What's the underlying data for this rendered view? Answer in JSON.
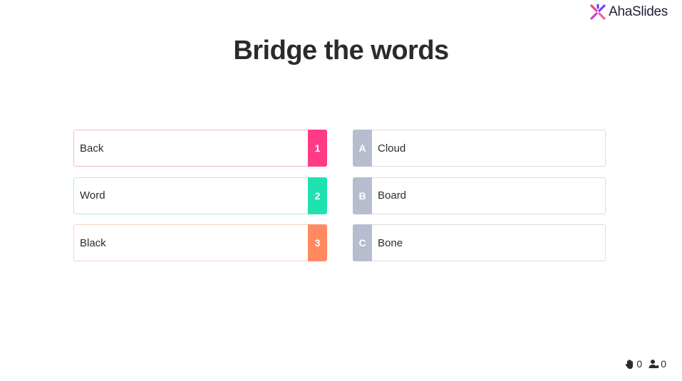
{
  "brand": {
    "name": "AhaSlides",
    "logo_icon": "ahaslides-logo-icon"
  },
  "slide": {
    "title": "Bridge the words"
  },
  "left_items": [
    {
      "text": "Back",
      "badge": "1",
      "color": "#ff3b86"
    },
    {
      "text": "Word",
      "badge": "2",
      "color": "#1ee2b0"
    },
    {
      "text": "Black",
      "badge": "3",
      "color": "#ff8a62"
    }
  ],
  "right_items": [
    {
      "text": "Cloud",
      "badge": "A"
    },
    {
      "text": "Board",
      "badge": "B"
    },
    {
      "text": "Bone",
      "badge": "C"
    }
  ],
  "footer": {
    "hands_count": "0",
    "hands_icon": "raised-hand-icon",
    "audience_count": "0",
    "audience_icon": "audience-icon"
  },
  "colors": {
    "badge_neutral": "#b7bdcf",
    "title": "#2b2b2b"
  }
}
